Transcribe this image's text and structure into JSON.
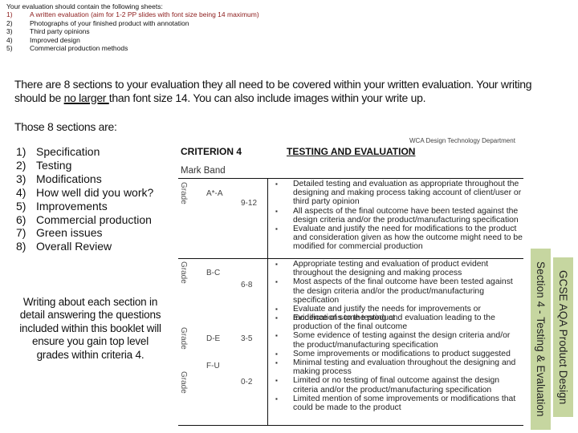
{
  "sheets": {
    "title": "Your evaluation should contain the following sheets:",
    "items": [
      {
        "num": "1)",
        "text": "A written evaluation (aim for 1-2 PP slides with font size being 14 maximum)",
        "highlight_color": "#8b1a1a"
      },
      {
        "num": "2)",
        "text": "Photographs of your finished product with annotation"
      },
      {
        "num": "3)",
        "text": "Third party opinions"
      },
      {
        "num": "4)",
        "text": "Improved design"
      },
      {
        "num": "5)",
        "text": "Commercial production methods"
      }
    ]
  },
  "intro": {
    "part1": "There are 8 sections to your evaluation they all need to be covered within your written evaluation. Your writing should be ",
    "underlined": "no larger ",
    "part2": "than font size 14. You can also include images within your write up."
  },
  "those_label": "Those 8 sections are:",
  "sections": [
    {
      "num": "1)",
      "text": "Specification"
    },
    {
      "num": "2)",
      "text": "Testing"
    },
    {
      "num": "3)",
      "text": "Modifications"
    },
    {
      "num": "4)",
      "text": "How well did you work?"
    },
    {
      "num": "5)",
      "text": "Improvements"
    },
    {
      "num": "6)",
      "text": "Commercial production"
    },
    {
      "num": "7)",
      "text": "Green issues"
    },
    {
      "num": "8)",
      "text": "Overall Review"
    }
  ],
  "note": "Writing about each section in detail answering the questions included within this booklet will ensure you gain top level grades within criteria 4.",
  "rubric": {
    "department": "WCA Design Technology Department",
    "criterion": "CRITERION 4",
    "heading": "TESTING AND EVALUATION",
    "mark_band_label": "Mark Band",
    "grade_label": "Grade",
    "bands": [
      {
        "grade": "A*-A",
        "marks": "9-12",
        "criteria": [
          "Detailed testing and evaluation as appropriate throughout the designing and making process taking account of client/user or third party opinion",
          "All aspects of the final outcome have been tested against the design criteria and/or the product/manufacturing specification",
          "Evaluate and justify the need for modifications to the product and consideration given as how the outcome might need to be modified for commercial production"
        ]
      },
      {
        "grade": "B-C",
        "marks": "6-8",
        "criteria": [
          "Appropriate testing and evaluation of product evident throughout the designing and making process",
          "Most aspects of the final outcome have been tested against the design criteria and/or the product/manufacturing specification",
          "Evaluate and justify the needs for improvements or modifications to the product"
        ]
      },
      {
        "grade": "D-E",
        "marks": "3-5",
        "criteria": [
          "Evidence of some testing and evaluation leading to the production of the final outcome",
          "Some evidence of testing against the design criteria and/or the product/manufacturing specification",
          "Some improvements or modifications to product suggested"
        ]
      },
      {
        "grade": "F-U",
        "marks": "0-2",
        "criteria": [
          "Minimal testing and evaluation throughout the designing and making process",
          "Limited or no testing of final outcome against the design criteria and/or the product/manufacturing specification",
          "Limited mention of some improvements or modifications that could be made to the product"
        ]
      }
    ]
  },
  "strips": {
    "section": "Section 4 - Testing & Evaluation",
    "course": "GCSE AQA Product Design",
    "color": "#c6d6a0"
  }
}
